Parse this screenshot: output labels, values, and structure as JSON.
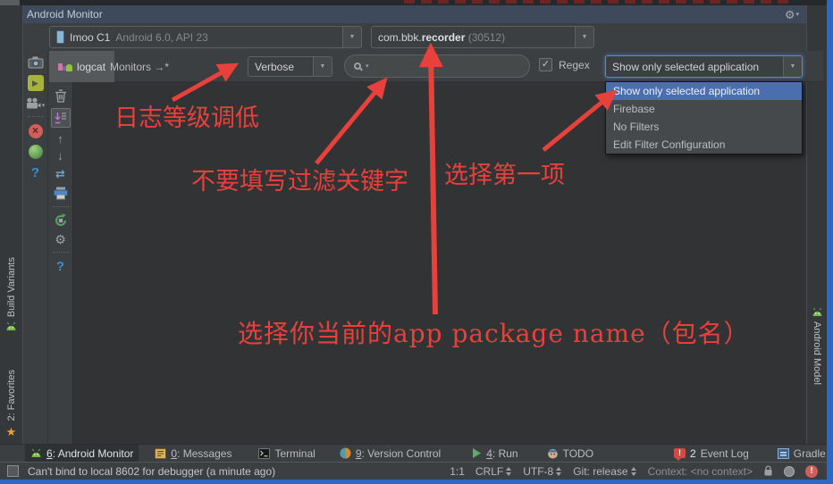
{
  "titlebar": {
    "title": "Android Monitor"
  },
  "device_bar": {
    "device_name": "Imoo C1",
    "device_details": "Android 6.0, API 23",
    "process_prefix": "com.bbk.",
    "process_bold": "recorder",
    "process_pid": "(30512)"
  },
  "logcat_bar": {
    "tab_logcat": "logcat",
    "tab_monitors": "Monitors →*",
    "level": "Verbose",
    "search_value": "",
    "regex_label": "Regex",
    "filter_value": "Show only selected application"
  },
  "filter_dropdown": {
    "items": [
      "Show only selected application",
      "Firebase",
      "No Filters",
      "Edit Filter Configuration"
    ],
    "selected_index": 0
  },
  "annotations": {
    "log_level": "日志等级调低",
    "no_keyword": "不要填写过滤关键字",
    "select_first": "选择第一项",
    "select_package": "选择你当前的app package name（包名）"
  },
  "rails": {
    "build_variants": "Build Variants",
    "favorites": "2: Favorites",
    "android_model": "Android Model"
  },
  "bottom_tabs": [
    {
      "mnemonic": "6",
      "rest": ": Android Monitor"
    },
    {
      "mnemonic": "0",
      "rest": ": Messages"
    },
    {
      "mnemonic": "",
      "rest": "Terminal"
    },
    {
      "mnemonic": "9",
      "rest": ": Version Control"
    },
    {
      "mnemonic": "4",
      "rest": ": Run"
    },
    {
      "mnemonic": "",
      "rest": "TODO"
    },
    {
      "mnemonic": "",
      "rest": "Event Log",
      "badge": "2"
    },
    {
      "mnemonic": "",
      "rest": "Gradle Console"
    }
  ],
  "status_bar": {
    "message": "Can't bind to local 8602 for debugger (a minute ago)",
    "caret": "1:1",
    "line_sep": "CRLF",
    "encoding": "UTF-8",
    "git": "Git: release",
    "context": "Context: <no context>"
  },
  "icons": {
    "gear": "⚙",
    "dropdown_arrow": "▼",
    "small_arrow": "▾",
    "up": "↑",
    "down": "↓",
    "swap": "⇄",
    "help": "?",
    "check": "✓",
    "play": "▶",
    "star": "★",
    "exclaim": "!",
    "close": "×"
  },
  "colors": {
    "annotation_red": "#e8413c",
    "selection_blue": "#4b6eaf",
    "focus_border": "#5d8cc9",
    "window_edge_blue": "#2e68c5"
  }
}
